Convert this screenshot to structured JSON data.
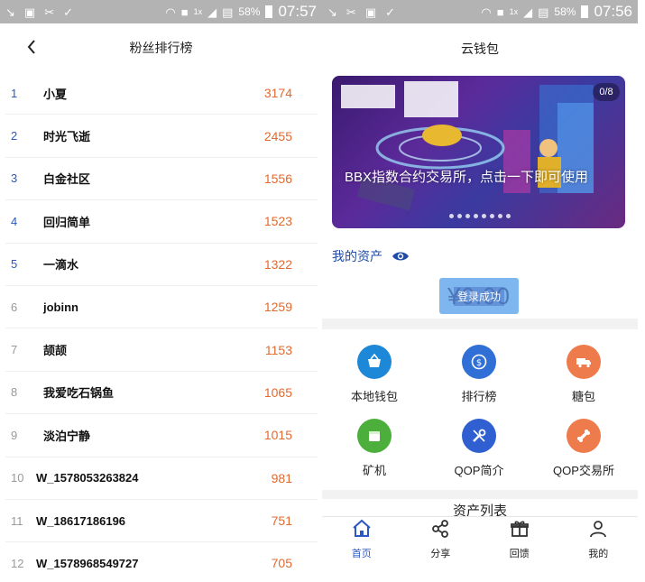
{
  "left": {
    "status": {
      "battery": "58%",
      "time": "07:57",
      "net": "1x"
    },
    "header": {
      "title": "粉丝排行榜"
    },
    "rankings": [
      {
        "rank": "1",
        "name": "小夏",
        "score": "3174"
      },
      {
        "rank": "2",
        "name": "时光飞逝",
        "score": "2455"
      },
      {
        "rank": "3",
        "name": "白金社区",
        "score": "1556"
      },
      {
        "rank": "4",
        "name": "回归简单",
        "score": "1523"
      },
      {
        "rank": "5",
        "name": "一滴水",
        "score": "1322"
      },
      {
        "rank": "6",
        "name": "jobinn",
        "score": "1259"
      },
      {
        "rank": "7",
        "name": "颉颉",
        "score": "1153"
      },
      {
        "rank": "8",
        "name": "我爱吃石锅鱼",
        "score": "1065"
      },
      {
        "rank": "9",
        "name": "淡泊宁静",
        "score": "1015"
      },
      {
        "rank": "10",
        "name": "W_1578053263824",
        "score": "981"
      },
      {
        "rank": "11",
        "name": "W_18617186196",
        "score": "751"
      },
      {
        "rank": "12",
        "name": "W_1578968549727",
        "score": "705"
      }
    ]
  },
  "right": {
    "status": {
      "battery": "58%",
      "time": "07:56",
      "net": "1x"
    },
    "header": {
      "title": "云钱包"
    },
    "banner": {
      "counter": "0/8",
      "text": "BBX指数合约交易所，点击一下即可使用",
      "dots": 8
    },
    "assets": {
      "label": "我的资产",
      "amount": "¥0.00",
      "toast": "登录成功"
    },
    "grid": [
      {
        "label": "本地钱包",
        "icon": "basket-icon",
        "color": "#1e88d8"
      },
      {
        "label": "排行榜",
        "icon": "coin-icon",
        "color": "#2f6fd6"
      },
      {
        "label": "糖包",
        "icon": "truck-icon",
        "color": "#ee7b4c"
      },
      {
        "label": "矿机",
        "icon": "box-icon",
        "color": "#4caf3c"
      },
      {
        "label": "QOP简介",
        "icon": "wrench-icon",
        "color": "#2f5fd0"
      },
      {
        "label": "QOP交易所",
        "icon": "bone-icon",
        "color": "#ee7b4c"
      }
    ],
    "asset_list": {
      "title": "资产列表"
    },
    "tabs": [
      {
        "label": "首页",
        "icon": "home-icon",
        "active": true
      },
      {
        "label": "分享",
        "icon": "share-icon",
        "active": false
      },
      {
        "label": "回馈",
        "icon": "gift-icon",
        "active": false
      },
      {
        "label": "我的",
        "icon": "user-icon",
        "active": false
      }
    ],
    "accent": "#2a59c4"
  }
}
